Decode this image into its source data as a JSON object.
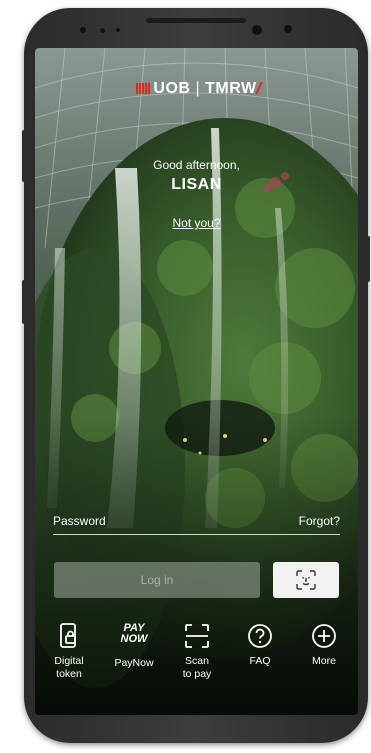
{
  "brand": {
    "logo_left": "UOB",
    "logo_right": "TMRW"
  },
  "login": {
    "greeting": "Good afternoon,",
    "username": "LISAN",
    "not_you": "Not you?",
    "password_label": "Password",
    "forgot": "Forgot?",
    "login_button": "Log in"
  },
  "quick_actions": [
    {
      "line1": "Digital",
      "line2": "token",
      "icon": "digital-token-icon"
    },
    {
      "line1": "PayNow",
      "line2": "",
      "icon": "paynow-icon",
      "icon_text1": "PAY",
      "icon_text2": "NOW"
    },
    {
      "line1": "Scan",
      "line2": "to pay",
      "icon": "scan-icon"
    },
    {
      "line1": "FAQ",
      "line2": "",
      "icon": "faq-icon"
    },
    {
      "line1": "More",
      "line2": "",
      "icon": "plus-icon"
    }
  ],
  "colors": {
    "brand_red": "#e1261c",
    "login_disabled": "#a0aaa0"
  }
}
